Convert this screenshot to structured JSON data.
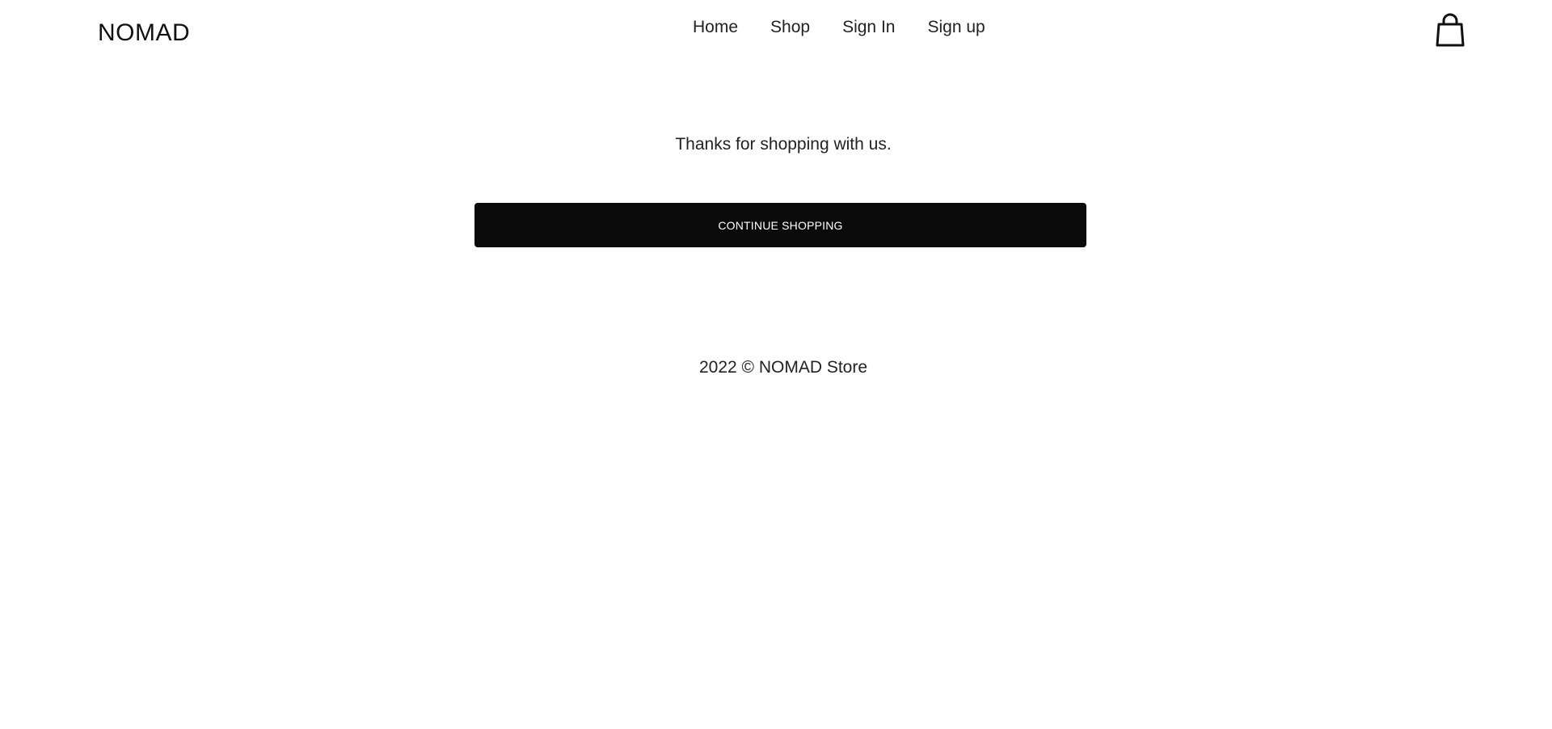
{
  "header": {
    "brand": "NOMAD",
    "nav": [
      {
        "label": "Home"
      },
      {
        "label": "Shop"
      },
      {
        "label": "Sign In"
      },
      {
        "label": "Sign up"
      }
    ],
    "cart_icon": "shopping-bag-icon"
  },
  "main": {
    "message": "Thanks for shopping with us.",
    "continue_label": "CONTINUE SHOPPING"
  },
  "footer": {
    "text": "2022 © NOMAD Store"
  },
  "colors": {
    "button_bg": "#0b0b0b",
    "button_text": "#ffffff",
    "background": "#ffffff"
  }
}
